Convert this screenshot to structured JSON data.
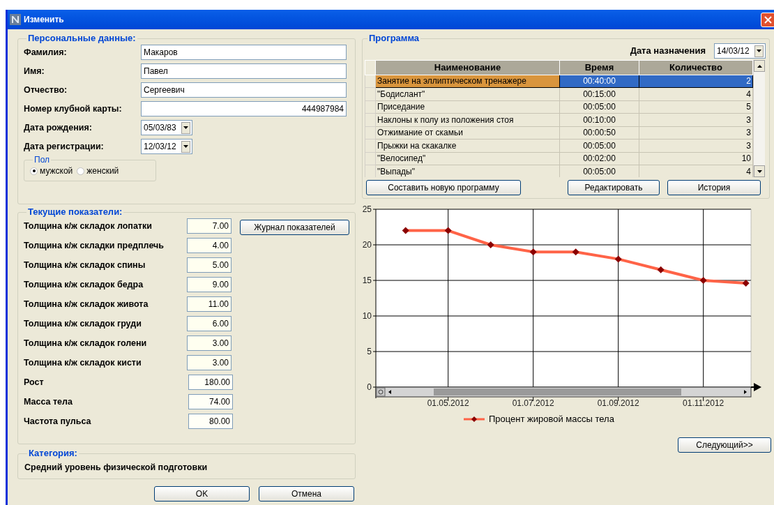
{
  "window": {
    "title": "Изменить"
  },
  "personal": {
    "title": "Персональные данные:",
    "fields": [
      {
        "label": "Фамилия:",
        "value": "Макаров",
        "kind": "text"
      },
      {
        "label": "Имя:",
        "value": "Павел",
        "kind": "text"
      },
      {
        "label": "Отчество:",
        "value": "Сергеевич",
        "kind": "text"
      },
      {
        "label": "Номер клубной карты:",
        "value": "444987984",
        "kind": "number"
      },
      {
        "label": "Дата рождения:",
        "value": "05/03/83",
        "kind": "date"
      },
      {
        "label": "Дата регистрации:",
        "value": "12/03/12",
        "kind": "date"
      }
    ],
    "gender": {
      "title": "Пол",
      "options": [
        {
          "label": "мужской",
          "selected": true
        },
        {
          "label": "женский",
          "selected": false
        }
      ]
    }
  },
  "metrics": {
    "title": "Текущие показатели:",
    "journal_button": "Журнал показателей",
    "rows": [
      {
        "label": "Толщина к/ж складок лопатки",
        "value": "7.00",
        "kind": "fold"
      },
      {
        "label": "Толщина к/ж складки предплечь",
        "value": "4.00",
        "kind": "fold"
      },
      {
        "label": "Толщина к/ж складок спины",
        "value": "5.00",
        "kind": "fold"
      },
      {
        "label": "Толщина к/ж складок бедра",
        "value": "9.00",
        "kind": "fold"
      },
      {
        "label": "Толщина к/ж складок живота",
        "value": "11.00",
        "kind": "fold"
      },
      {
        "label": "Толщина к/ж складок груди",
        "value": "6.00",
        "kind": "fold"
      },
      {
        "label": "Толщина к/ж складок голени",
        "value": "3.00",
        "kind": "fold"
      },
      {
        "label": "Толщина к/ж складок кисти",
        "value": "3.00",
        "kind": "fold"
      },
      {
        "label": "Рост",
        "value": "180.00",
        "kind": "body"
      },
      {
        "label": "Масса тела",
        "value": "74.00",
        "kind": "body"
      },
      {
        "label": "Частота пульса",
        "value": "80.00",
        "kind": "body"
      }
    ]
  },
  "category": {
    "title": "Категория:",
    "text": "Средний уровень физической подготовки"
  },
  "program": {
    "title": "Программа",
    "date_label": "Дата назначения",
    "date_value": "14/03/12",
    "table": {
      "columns": [
        "Наименование",
        "Время",
        "Количество"
      ],
      "rows": [
        {
          "cells": [
            "Занятие на эллиптическом тренажере",
            "00:40:00",
            "2"
          ],
          "selected": true
        },
        {
          "cells": [
            "\"Бодислант\"",
            "00:15:00",
            "4"
          ],
          "selected": false
        },
        {
          "cells": [
            "Приседание",
            "00:05:00",
            "5"
          ],
          "selected": false
        },
        {
          "cells": [
            "Наклоны к полу из положения стоя",
            "00:10:00",
            "3"
          ],
          "selected": false
        },
        {
          "cells": [
            "Отжимание от скамьи",
            "00:00:50",
            "3"
          ],
          "selected": false
        },
        {
          "cells": [
            "Прыжки на скакалке",
            "00:05:00",
            "3"
          ],
          "selected": false
        },
        {
          "cells": [
            "\"Велосипед\"",
            "00:02:00",
            "10"
          ],
          "selected": false
        },
        {
          "cells": [
            "\"Выпады\"",
            "00:05:00",
            "4"
          ],
          "selected": false
        }
      ]
    },
    "buttons": [
      "Составить новую программу",
      "Редактировать",
      "История"
    ]
  },
  "chart": {
    "chart_data": {
      "type": "line",
      "categories": [
        null,
        "01.05.2012",
        null,
        "01.07.2012",
        null,
        "01.09.2012",
        null,
        "01.11.2012",
        null
      ],
      "series": [
        {
          "name": "Процент жировой массы тела",
          "color": "#ff6347",
          "marker": "diamond",
          "values": [
            22,
            22,
            20,
            19,
            19,
            18,
            16.5,
            15,
            14.6
          ]
        }
      ],
      "ylim": [
        0,
        25
      ],
      "grid": true,
      "yticks": [
        0,
        5,
        10,
        15,
        20,
        25
      ]
    }
  },
  "next_button": "Следующий>>",
  "buttons": [
    "OK",
    "Отмена"
  ]
}
